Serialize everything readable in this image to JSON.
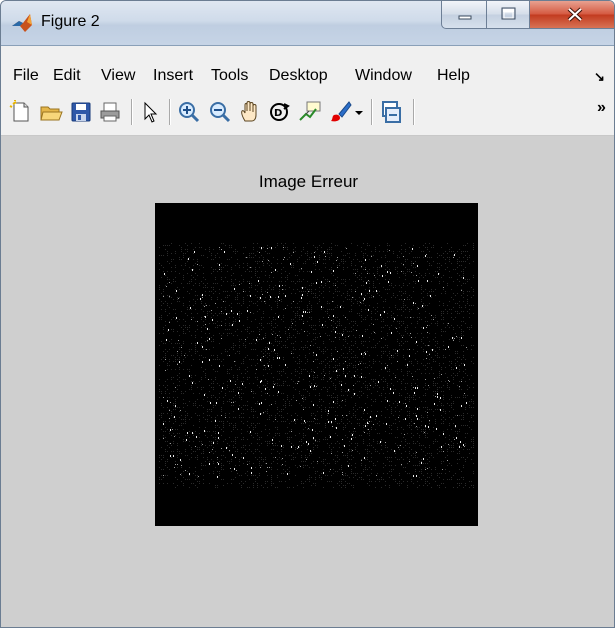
{
  "window": {
    "title": "Figure 2",
    "controls": [
      "minimize",
      "maximize",
      "close"
    ]
  },
  "menu": {
    "items": [
      "File",
      "Edit",
      "View",
      "Insert",
      "Tools",
      "Desktop",
      "Window",
      "Help"
    ],
    "overflow_glyph": "↘"
  },
  "toolbar": {
    "buttons": [
      {
        "name": "new-figure-icon"
      },
      {
        "name": "open-file-icon"
      },
      {
        "name": "save-figure-icon"
      },
      {
        "name": "print-figure-icon"
      },
      {
        "name": "edit-plot-arrow-icon"
      },
      {
        "name": "zoom-in-icon"
      },
      {
        "name": "zoom-out-icon"
      },
      {
        "name": "pan-hand-icon"
      },
      {
        "name": "rotate-3d-icon"
      },
      {
        "name": "data-cursor-icon"
      },
      {
        "name": "brush-icon"
      },
      {
        "name": "brush-dropdown-icon"
      },
      {
        "name": "link-plot-icon"
      }
    ],
    "overflow_glyph": "»"
  },
  "figure": {
    "axes_title": "Image Erreur",
    "image_colormap": "grayscale"
  },
  "colors": {
    "figure_background": "#cfcfcf",
    "toolbar_background": "#f0f0f0",
    "image_background": "#000000"
  }
}
